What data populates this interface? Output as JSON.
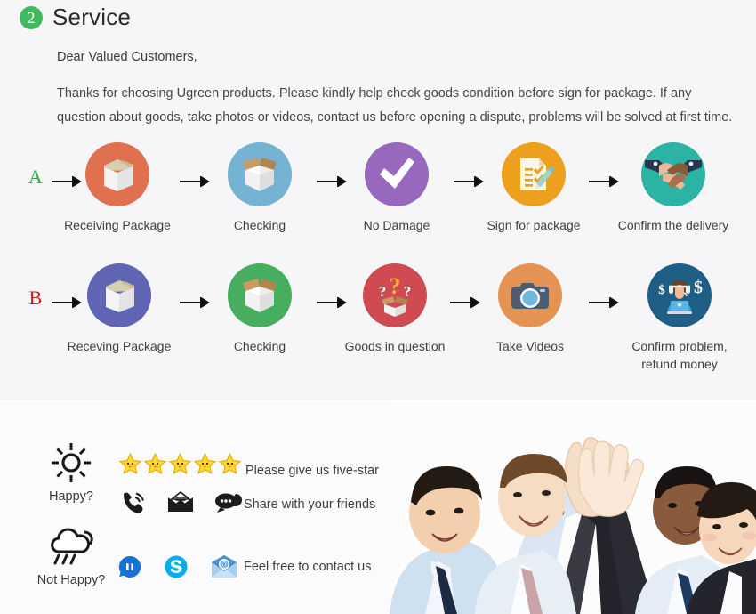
{
  "section": {
    "badge_number": "2",
    "title": "Service",
    "salutation": "Dear Valued Customers,",
    "body": "Thanks for choosing Ugreen products. Please kindly help check goods condition before sign for package. If any question about goods, take photos or videos, contact us before opening a dispute, problems will be solved at first time."
  },
  "flows": [
    {
      "letter": "A",
      "letter_color": "#2fa84f",
      "steps": [
        {
          "label": "Receiving Package",
          "icon": "closed-box-icon",
          "color": "#e0704f"
        },
        {
          "label": "Checking",
          "icon": "open-box-icon",
          "color": "#76b2d4"
        },
        {
          "label": "No Damage",
          "icon": "checkmark-icon",
          "color": "#9768bd"
        },
        {
          "label": "Sign for package",
          "icon": "clipboard-pencil-icon",
          "color": "#eda01e"
        },
        {
          "label": "Confirm the delivery",
          "icon": "handshake-icon",
          "color": "#2bb3a3"
        }
      ]
    },
    {
      "letter": "B",
      "letter_color": "#c62222",
      "steps": [
        {
          "label": "Receving Package",
          "icon": "closed-box-icon",
          "color": "#5f64b5"
        },
        {
          "label": "Checking",
          "icon": "open-box-icon",
          "color": "#47ad5f"
        },
        {
          "label": "Goods in question",
          "icon": "question-box-icon",
          "color": "#cf4a51"
        },
        {
          "label": "Take Videos",
          "icon": "camera-icon",
          "color": "#e59352"
        },
        {
          "label": "Confirm problem,\nrefund money",
          "icon": "support-agent-icon",
          "color": "#1f5f86"
        }
      ]
    }
  ],
  "support": {
    "happy_label": "Happy?",
    "happy_icon": "sun-icon",
    "not_happy_label": "Not Happy?",
    "not_happy_icon": "rain-cloud-icon",
    "star_count": 5,
    "notes": {
      "five_star": "Please give us five-star",
      "share": "Share with your friends",
      "contact": "Feel free to contact us"
    },
    "share_icons": [
      "phone-icon",
      "envelope-icon",
      "chat-bubble-icon"
    ],
    "contact_icons": [
      "aliwangwang-icon",
      "skype-icon",
      "email-icon"
    ]
  },
  "photo": {
    "alt": "business-team-high-five-photo"
  },
  "colors": {
    "panel_bg": "#f6f5f7",
    "bottom_bg": "#fbfafc",
    "badge_green": "#41b95f",
    "star_yellow": "#ffd633",
    "skype_blue": "#00aff0"
  }
}
